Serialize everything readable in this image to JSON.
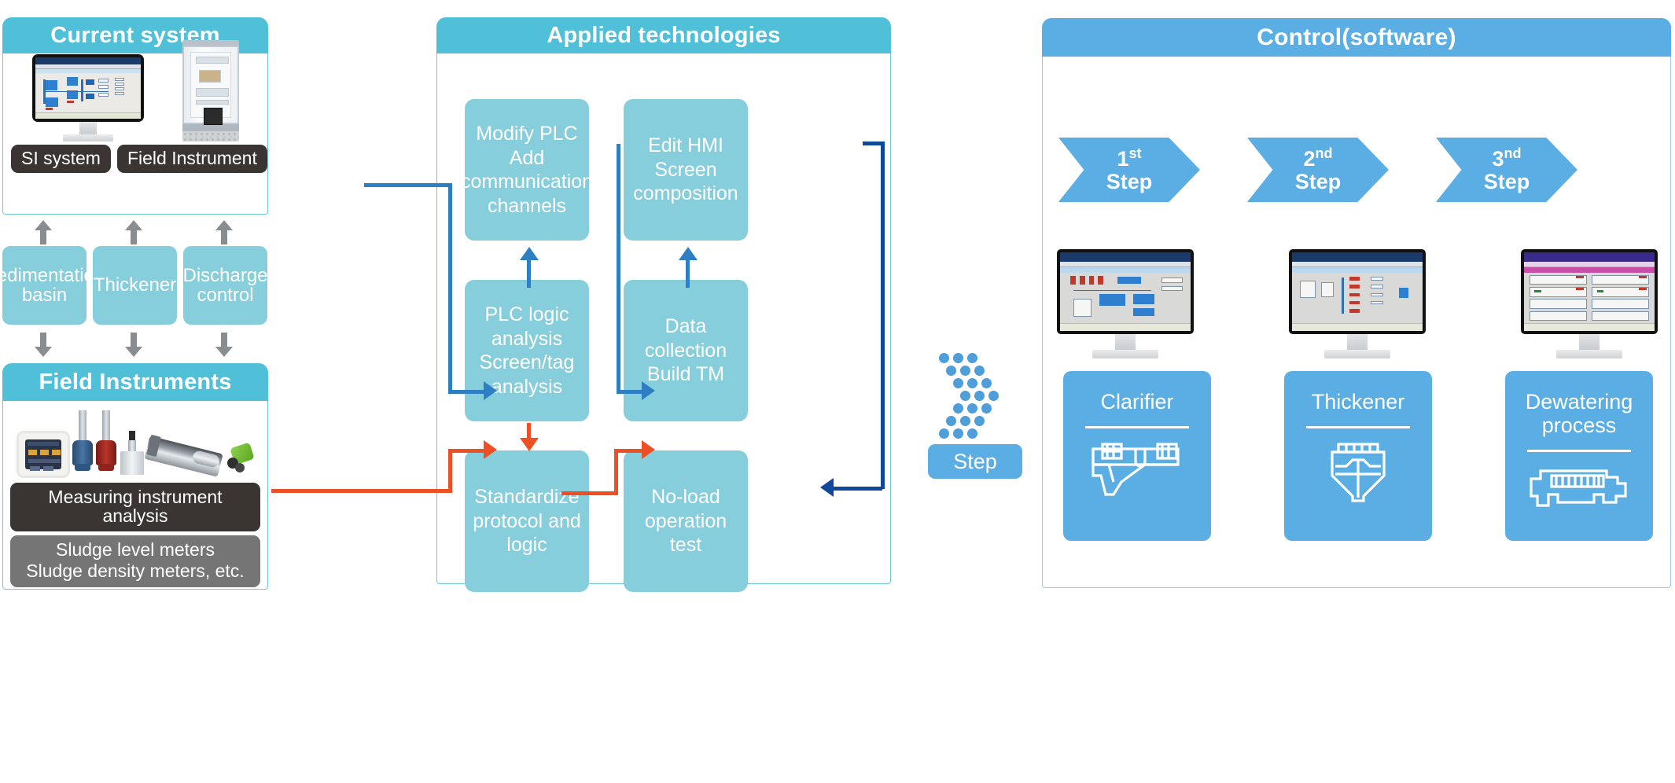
{
  "panels": {
    "current_system": {
      "title": "Current system",
      "devices": [
        {
          "label": "SI system",
          "icon": "monitor-icon"
        },
        {
          "label": "Field Instrument",
          "icon": "control-cabinet-icon"
        }
      ]
    },
    "process_boxes": [
      {
        "label": "Sedimentation basin"
      },
      {
        "label": "Thickener"
      },
      {
        "label": "Discharge control"
      }
    ],
    "field_instruments": {
      "title": "Field Instruments",
      "dark_tag": "Measuring instrument analysis",
      "gray_tag": "Sludge level meters\nSludge density meters, etc."
    },
    "applied_technologies": {
      "title": "Applied technologies",
      "boxes": [
        {
          "id": "modify-plc",
          "label": "Modify PLC\nAdd\ncommunication\nchannels"
        },
        {
          "id": "edit-hmi",
          "label": "Edit HMI\nScreen\ncomposition"
        },
        {
          "id": "plc-logic",
          "label": "PLC logic\nanalysis\nScreen/tag\nanalysis"
        },
        {
          "id": "data-collection",
          "label": "Data collection\nBuild TM"
        },
        {
          "id": "standardize",
          "label": "Standardize\nprotocol and\nlogic"
        },
        {
          "id": "no-load",
          "label": "No-load\noperation test"
        }
      ]
    },
    "step_connector": {
      "label": "Step",
      "icon": "dotted-chevron-right-icon"
    },
    "control_software": {
      "title": "Control(software)",
      "steps": [
        {
          "ordinal": "1",
          "suffix": "st",
          "word": "Step"
        },
        {
          "ordinal": "2",
          "suffix": "nd",
          "word": "Step"
        },
        {
          "ordinal": "3",
          "suffix": "nd",
          "word": "Step"
        }
      ],
      "monitors": [
        {
          "name": "hmi-screen-1"
        },
        {
          "name": "hmi-screen-2"
        },
        {
          "name": "hmi-screen-3"
        }
      ],
      "cards": [
        {
          "label": "Clarifier",
          "icon": "clarifier-icon"
        },
        {
          "label": "Thickener",
          "icon": "thickener-icon"
        },
        {
          "label": "Dewatering process",
          "icon": "dewatering-icon"
        }
      ]
    }
  },
  "colors": {
    "header_cyan": "#4FC0D8",
    "header_blue": "#5BAEE3",
    "box_light_teal": "#87CEDD",
    "arrow_blue": "#2E7EC4",
    "arrow_navy": "#10499A",
    "arrow_orange": "#EE5026",
    "arrow_gray": "#8A8D90",
    "tag_dark": "#3A3532",
    "tag_gray": "#757575"
  }
}
